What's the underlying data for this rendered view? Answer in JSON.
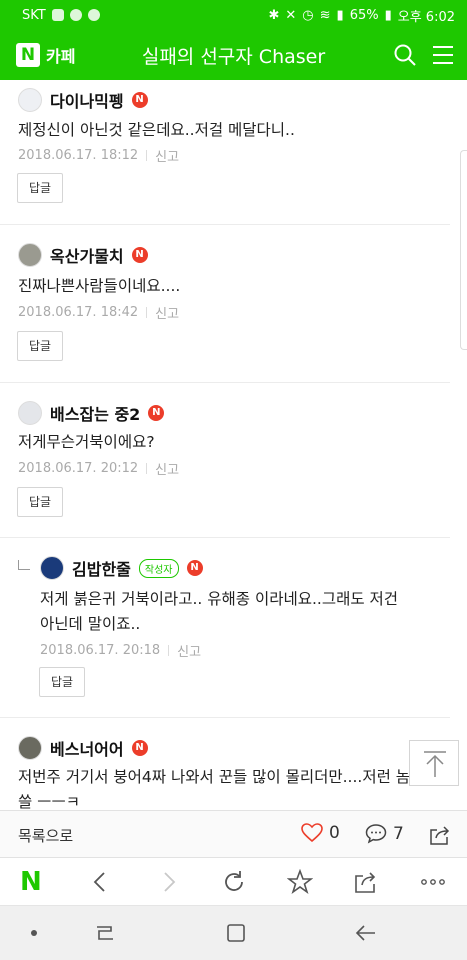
{
  "status_bar": {
    "carrier": "SKT",
    "battery": "65%",
    "time": "오후 6:02"
  },
  "header": {
    "logo_text": "카페",
    "cafe_title": "실패의 선구자 Chaser"
  },
  "comments": [
    {
      "nickname": "다이나믹펭",
      "text": "제정신이 아닌것 같은데요..저걸 메달다니..",
      "date": "2018.06.17. 18:12",
      "report": "신고",
      "reply": "답글"
    },
    {
      "nickname": "옥산가물치",
      "text": "진짜나쁜사람들이네요....",
      "date": "2018.06.17. 18:42",
      "report": "신고",
      "reply": "답글"
    },
    {
      "nickname": "배스잡는 중2",
      "text": "저게무슨거북이에요?",
      "date": "2018.06.17. 20:12",
      "report": "신고",
      "reply": "답글"
    },
    {
      "nickname": "김밥한줄",
      "writer_badge": "작성자",
      "text_line1": "저게 붉은귀 거북이라고.. 유해종 이라네요..그래도 저건",
      "text_line2": "아닌데 말이죠..",
      "date": "2018.06.17. 20:18",
      "report": "신고",
      "reply": "답글"
    },
    {
      "nickname": "베스너어어",
      "text_line1": "저번주 거기서 붕어4짜 나와서 꾼들 많이 몰리더만....저런 놈",
      "text_line2": "쓸 ㅡㅡㅋ"
    }
  ],
  "n_badge": "N",
  "bottom_bar": {
    "list_label": "목록으로",
    "like_count": "0",
    "comment_count": "7"
  },
  "browser_bar": {
    "naver_logo": "N"
  },
  "colors": {
    "brand_green": "#1ec800",
    "badge_red": "#ec3d2a"
  }
}
